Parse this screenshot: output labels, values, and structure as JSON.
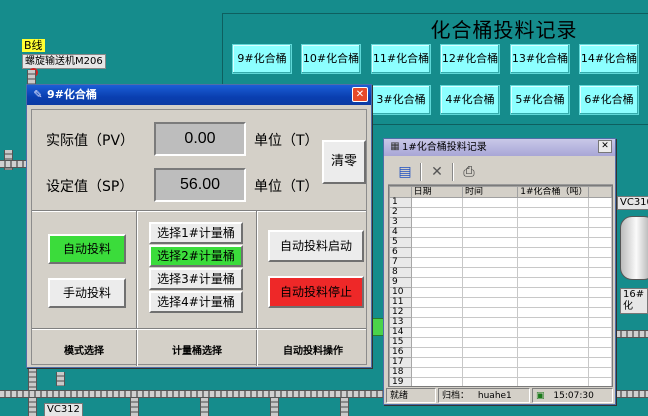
{
  "background": {
    "title": "化合桶投料记录",
    "tank_buttons": [
      "9#化合桶",
      "10#化合桶",
      "11#化合桶",
      "12#化合桶",
      "13#化合桶",
      "14#化合桶",
      "3#化合桶",
      "4#化合桶",
      "5#化合桶",
      "6#化合桶"
    ],
    "line_label": "B线",
    "conveyor_label": "螺旋输送机M206",
    "vc_left": "VC312",
    "vc_right": "VC310",
    "tank_right_label": "16#化"
  },
  "window9": {
    "title": "9#化合桶",
    "close": "✕",
    "pv_label": "实际值（PV）",
    "pv_value": "0.00",
    "sp_label": "设定值（SP）",
    "sp_value": "56.00",
    "unit_label": "单位（T）",
    "clear_button": "清零",
    "auto_feed": "自动投料",
    "manual_feed": "手动投料",
    "select_options": [
      "选择1#计量桶",
      "选择2#计量桶",
      "选择3#计量桶",
      "选择4#计量桶"
    ],
    "selected_index": 1,
    "auto_start": "自动投料启动",
    "auto_stop": "自动投料停止",
    "footer_mode": "模式选择",
    "footer_meter": "计量桶选择",
    "footer_auto": "自动投料操作"
  },
  "window1": {
    "title": "1#化合桶投料记录",
    "close": "✕",
    "columns": [
      "日期",
      "时间",
      "1#化合桶（吨）"
    ],
    "row_numbers": [
      "1",
      "2",
      "3",
      "4",
      "5",
      "6",
      "7",
      "8",
      "9",
      "10",
      "11",
      "12",
      "13",
      "14",
      "15",
      "16",
      "17",
      "18",
      "19"
    ],
    "status_ready": "就绪",
    "status_archive": "归档：",
    "status_user": "huahe1",
    "status_time": "15:07:30"
  },
  "colors": {
    "background": "#158c8c",
    "tank_button": "#8cffff",
    "active_green": "#3bdc3b",
    "stop_red": "#ee2828",
    "titlebar_blue": "#0a3fb0"
  }
}
